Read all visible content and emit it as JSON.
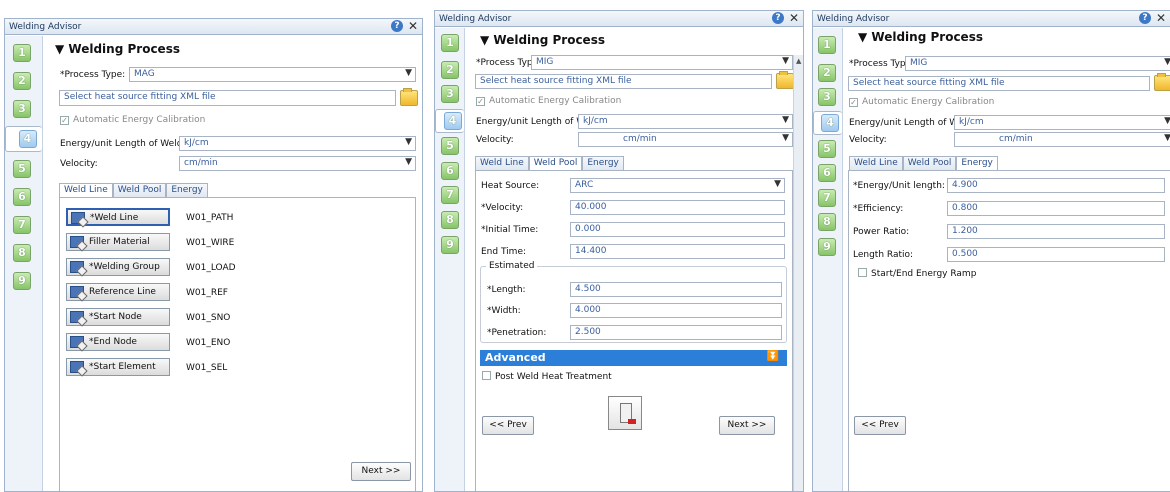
{
  "window_title": "Welding Advisor",
  "steps": [
    "1",
    "2",
    "3",
    "4",
    "5",
    "6",
    "7",
    "8",
    "9"
  ],
  "section_title": "Welding Process",
  "common": {
    "process_type_label": "*Process Type:",
    "heat_source_xml_placeholder": "Select heat source fitting XML file",
    "auto_calibration_label": "Automatic Energy Calibration",
    "energy_length_label": "Energy/unit Length of Weld:",
    "energy_length_unit": "kJ/cm",
    "velocity_label": "Velocity:",
    "velocity_unit": "cm/min",
    "tabs": [
      "Weld Line",
      "Weld Pool",
      "Energy"
    ],
    "next_label": "Next >>",
    "prev_label": "<< Prev"
  },
  "panel1": {
    "process_type": "MAG",
    "active_tab": "Weld Line",
    "weld_items": [
      {
        "label": "*Weld Line",
        "value": "W01_PATH"
      },
      {
        "label": "Filler Material",
        "value": "W01_WIRE"
      },
      {
        "label": "*Welding Group",
        "value": "W01_LOAD"
      },
      {
        "label": "Reference Line",
        "value": "W01_REF"
      },
      {
        "label": "*Start Node",
        "value": "W01_SNO"
      },
      {
        "label": "*End Node",
        "value": "W01_ENO"
      },
      {
        "label": "*Start Element",
        "value": "W01_SEL"
      }
    ]
  },
  "panel2": {
    "process_type": "MIG",
    "active_tab": "Weld Pool",
    "heat_source_label": "Heat Source:",
    "heat_source_value": "ARC",
    "velocity_label": "*Velocity:",
    "velocity_value": "40.000",
    "initial_time_label": "*Initial Time:",
    "initial_time_value": "0.000",
    "end_time_label": "End Time:",
    "end_time_value": "14.400",
    "estimated_legend": "Estimated",
    "length_label": "*Length:",
    "length_value": "4.500",
    "width_label": "*Width:",
    "width_value": "4.000",
    "penetration_label": "*Penetration:",
    "penetration_value": "2.500",
    "advanced_label": "Advanced",
    "post_weld_label": "Post Weld Heat Treatment"
  },
  "panel3": {
    "process_type": "MIG",
    "active_tab": "Energy",
    "energy_length_label": "*Energy/Unit length:",
    "energy_length_value": "4.900",
    "efficiency_label": "*Efficiency:",
    "efficiency_value": "0.800",
    "power_ratio_label": "Power Ratio:",
    "power_ratio_value": "1.200",
    "length_ratio_label": "Length Ratio:",
    "length_ratio_value": "0.500",
    "ramp_label": "Start/End Energy Ramp"
  },
  "colors": {
    "accent": "#2b7fd8",
    "step_green": "#87c468",
    "step_active": "#9fcaf0"
  },
  "icons": [
    "help-icon",
    "close-icon",
    "triangle-down-icon",
    "folder-icon",
    "weld-item-icon",
    "double-chevron-down-icon",
    "calculator-icon"
  ]
}
